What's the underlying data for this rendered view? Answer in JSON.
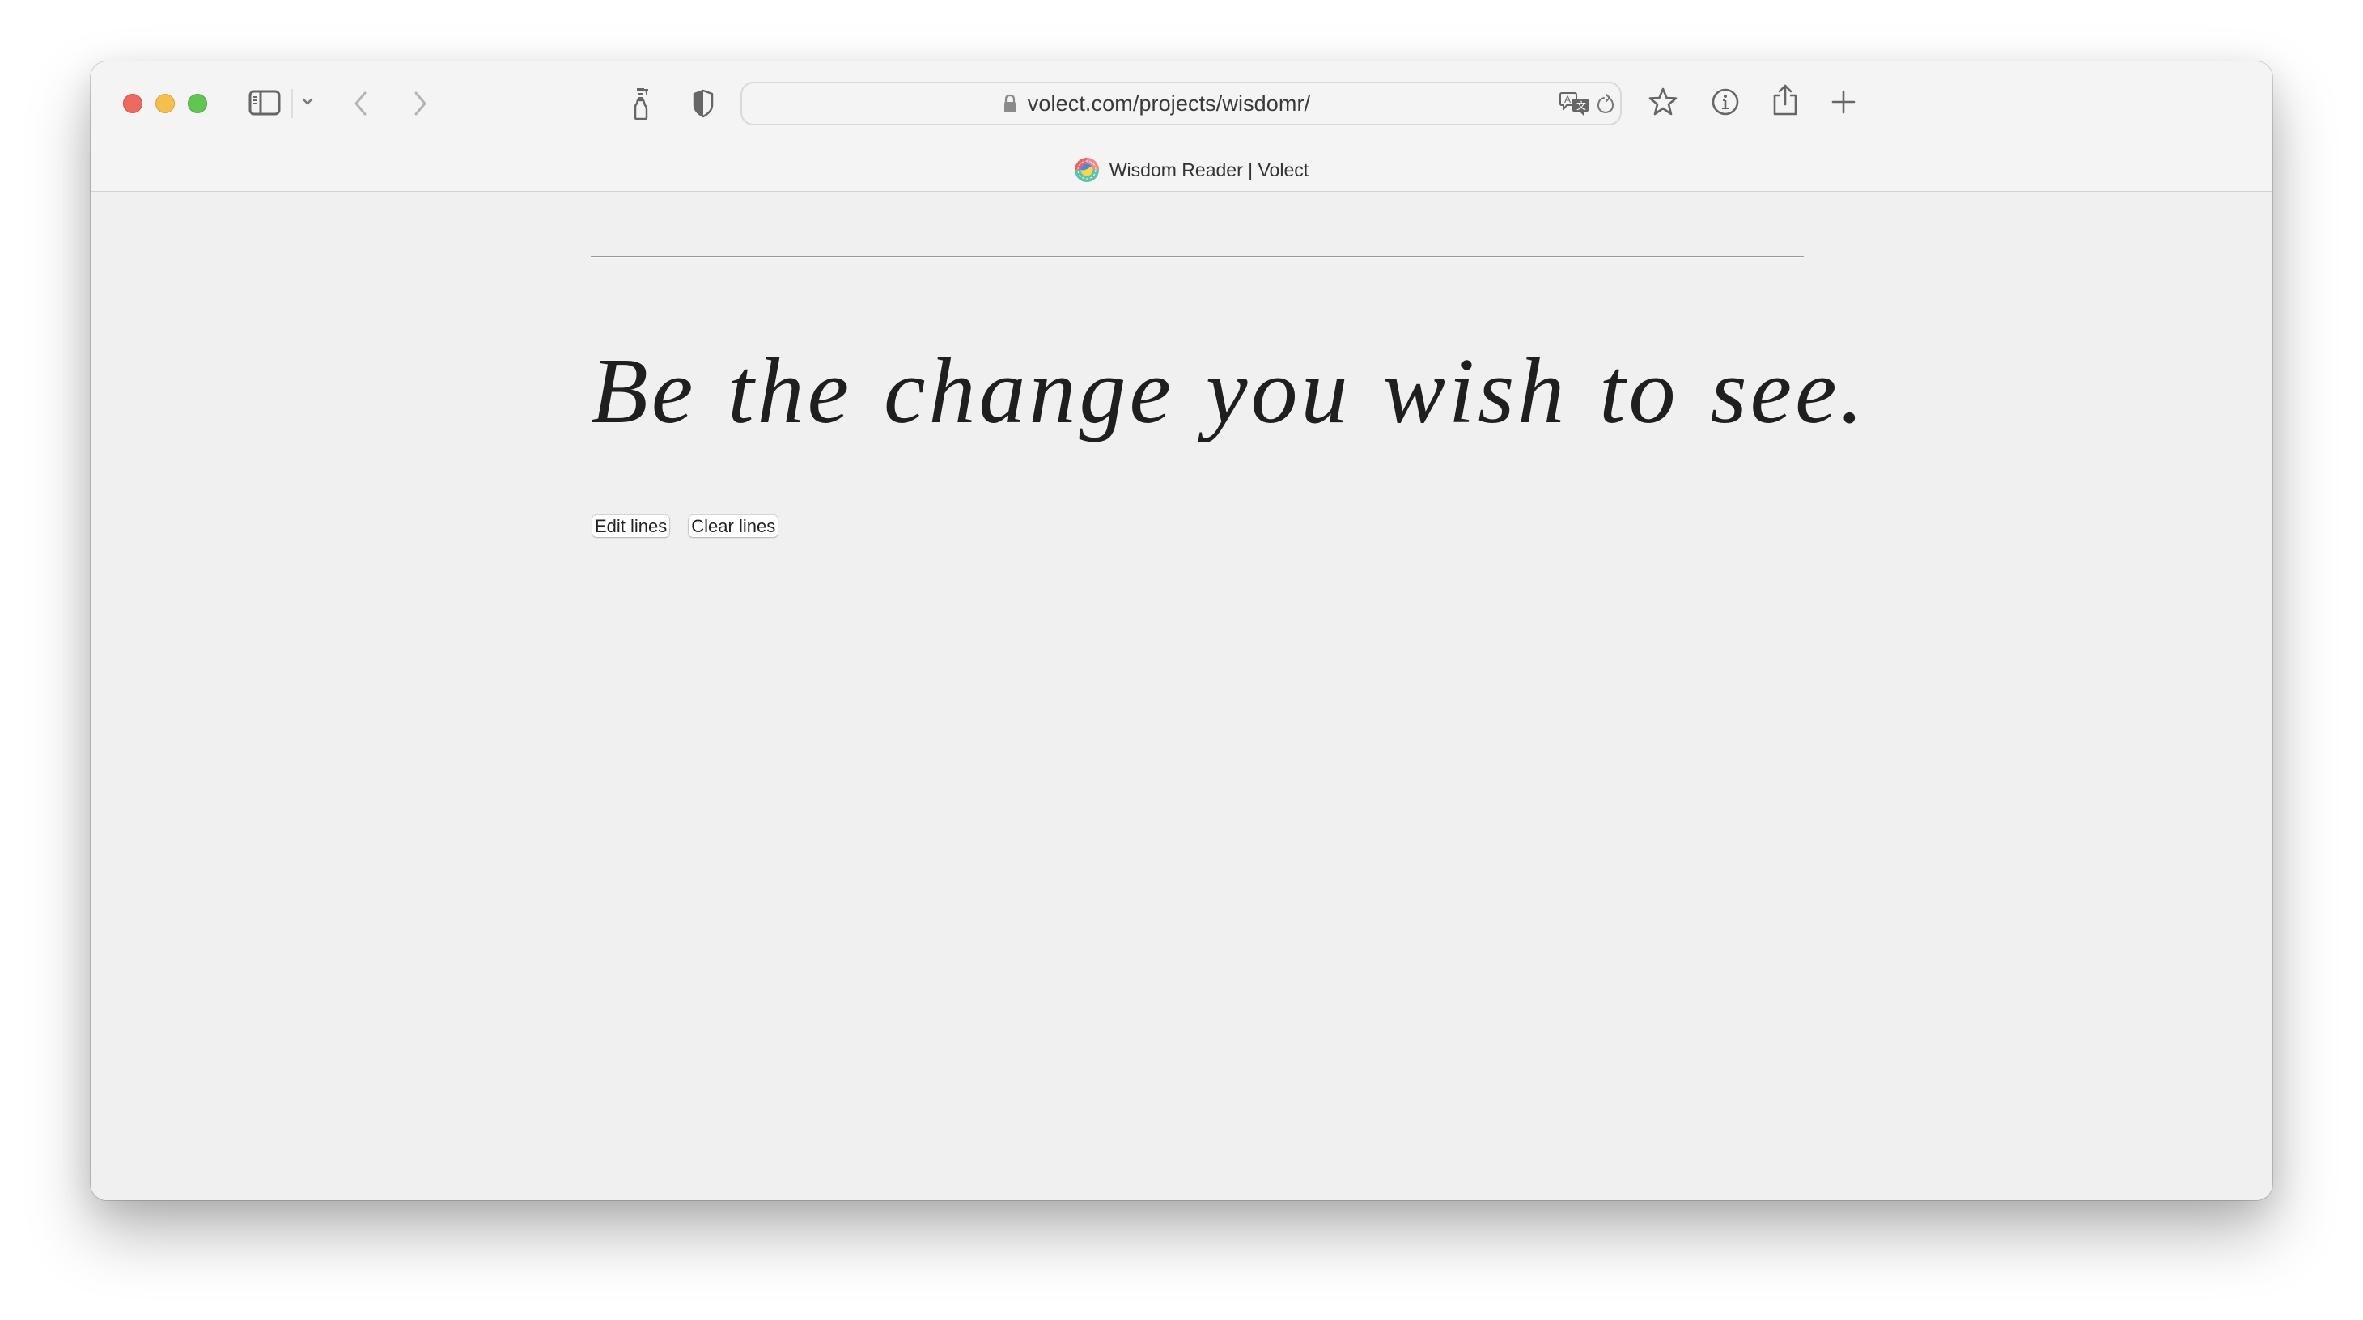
{
  "browser": {
    "url": "volect.com/projects/wisdomr/",
    "tab_title": "Wisdom Reader | Volect",
    "toolbar_icons": {
      "sidebar": "sidebar-icon",
      "sidebar_menu": "chevron-down-icon",
      "back": "chevron-left-icon",
      "forward": "chevron-right-icon",
      "extension": "spray-bottle-icon",
      "privacy": "shield-icon",
      "lock": "lock-icon",
      "translate": "translate-icon",
      "reload": "reload-icon",
      "bookmark": "star-icon",
      "info": "info-icon",
      "share": "share-icon",
      "new_tab": "plus-icon"
    },
    "window_controls": [
      "close",
      "minimize",
      "zoom"
    ]
  },
  "page": {
    "quote": "Be the change you wish to see.",
    "buttons": {
      "edit": "Edit lines",
      "clear": "Clear lines"
    }
  },
  "colors": {
    "close": "#ec6a5e",
    "minimize": "#f4bf4f",
    "zoom": "#61c554",
    "page_background": "#f0f0f0",
    "quote_text": "#1f1f1f"
  }
}
